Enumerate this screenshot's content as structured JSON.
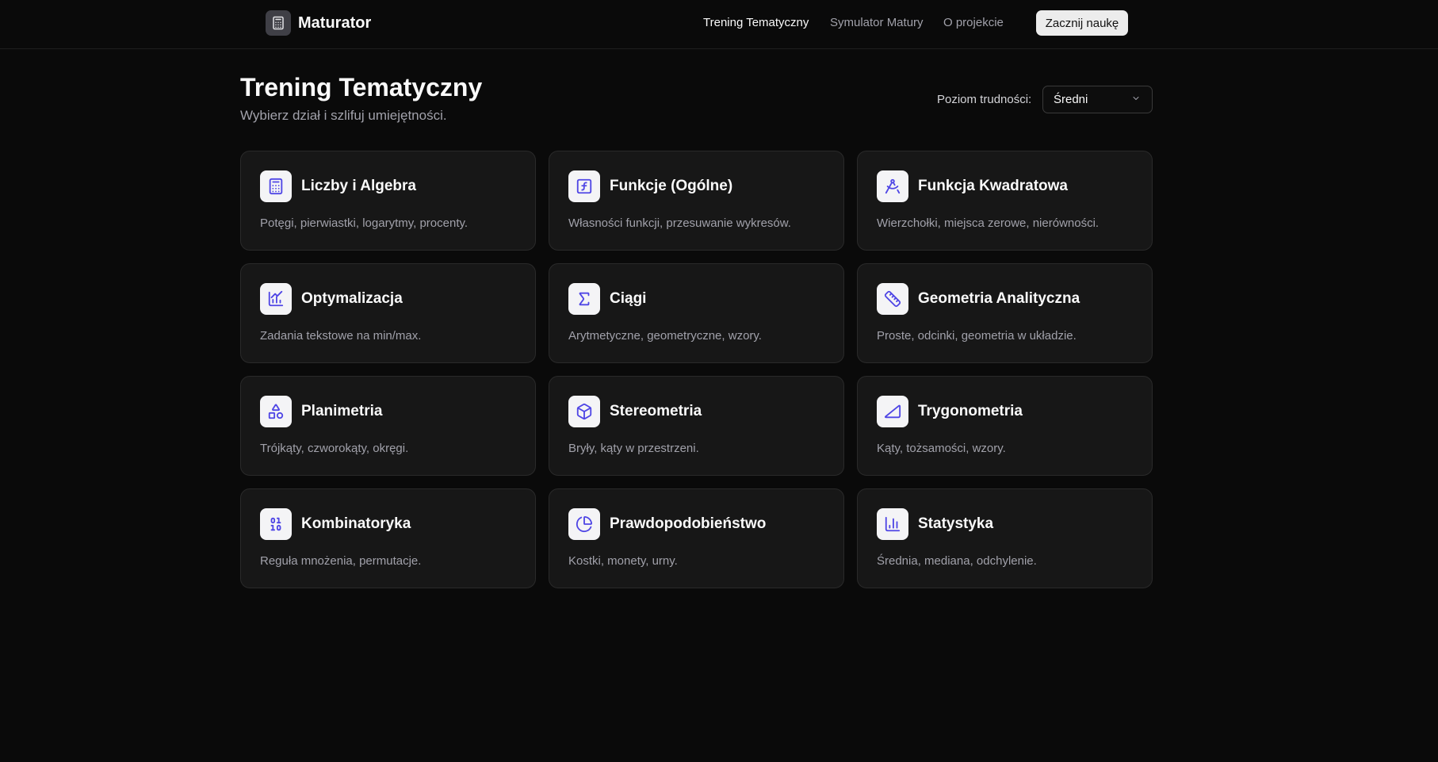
{
  "header": {
    "brand_name": "Maturator",
    "nav": [
      {
        "label": "Trening Tematyczny",
        "active": true
      },
      {
        "label": "Symulator Matury",
        "active": false
      },
      {
        "label": "O projekcie",
        "active": false
      }
    ],
    "cta_label": "Zacznij naukę"
  },
  "main": {
    "title": "Trening Tematyczny",
    "subtitle": "Wybierz dział i szlifuj umiejętności.",
    "difficulty_label": "Poziom trudności:",
    "difficulty_value": "Średni"
  },
  "colors": {
    "icon_accent": "#4f46e5",
    "background": "#0a0a0a",
    "card_background": "#171717"
  },
  "topics": [
    {
      "title": "Liczby i Algebra",
      "description": "Potęgi, pierwiastki, logarytmy, procenty.",
      "icon": "calculator-icon"
    },
    {
      "title": "Funkcje (Ogólne)",
      "description": "Własności funkcji, przesuwanie wykresów.",
      "icon": "function-icon"
    },
    {
      "title": "Funkcja Kwadratowa",
      "description": "Wierzchołki, miejsca zerowe, nierówności.",
      "icon": "compass-icon"
    },
    {
      "title": "Optymalizacja",
      "description": "Zadania tekstowe na min/max.",
      "icon": "chart-trend-icon"
    },
    {
      "title": "Ciągi",
      "description": "Arytmetyczne, geometryczne, wzory.",
      "icon": "sigma-icon"
    },
    {
      "title": "Geometria Analityczna",
      "description": "Proste, odcinki, geometria w układzie.",
      "icon": "ruler-icon"
    },
    {
      "title": "Planimetria",
      "description": "Trójkąty, czworokąty, okręgi.",
      "icon": "shapes-icon"
    },
    {
      "title": "Stereometria",
      "description": "Bryły, kąty w przestrzeni.",
      "icon": "cube-icon"
    },
    {
      "title": "Trygonometria",
      "description": "Kąty, tożsamości, wzory.",
      "icon": "triangle-right-icon"
    },
    {
      "title": "Kombinatoryka",
      "description": "Reguła mnożenia, permutacje.",
      "icon": "binary-icon"
    },
    {
      "title": "Prawdopodobieństwo",
      "description": "Kostki, monety, urny.",
      "icon": "pie-chart-icon"
    },
    {
      "title": "Statystyka",
      "description": "Średnia, mediana, odchylenie.",
      "icon": "bar-chart-icon"
    }
  ]
}
